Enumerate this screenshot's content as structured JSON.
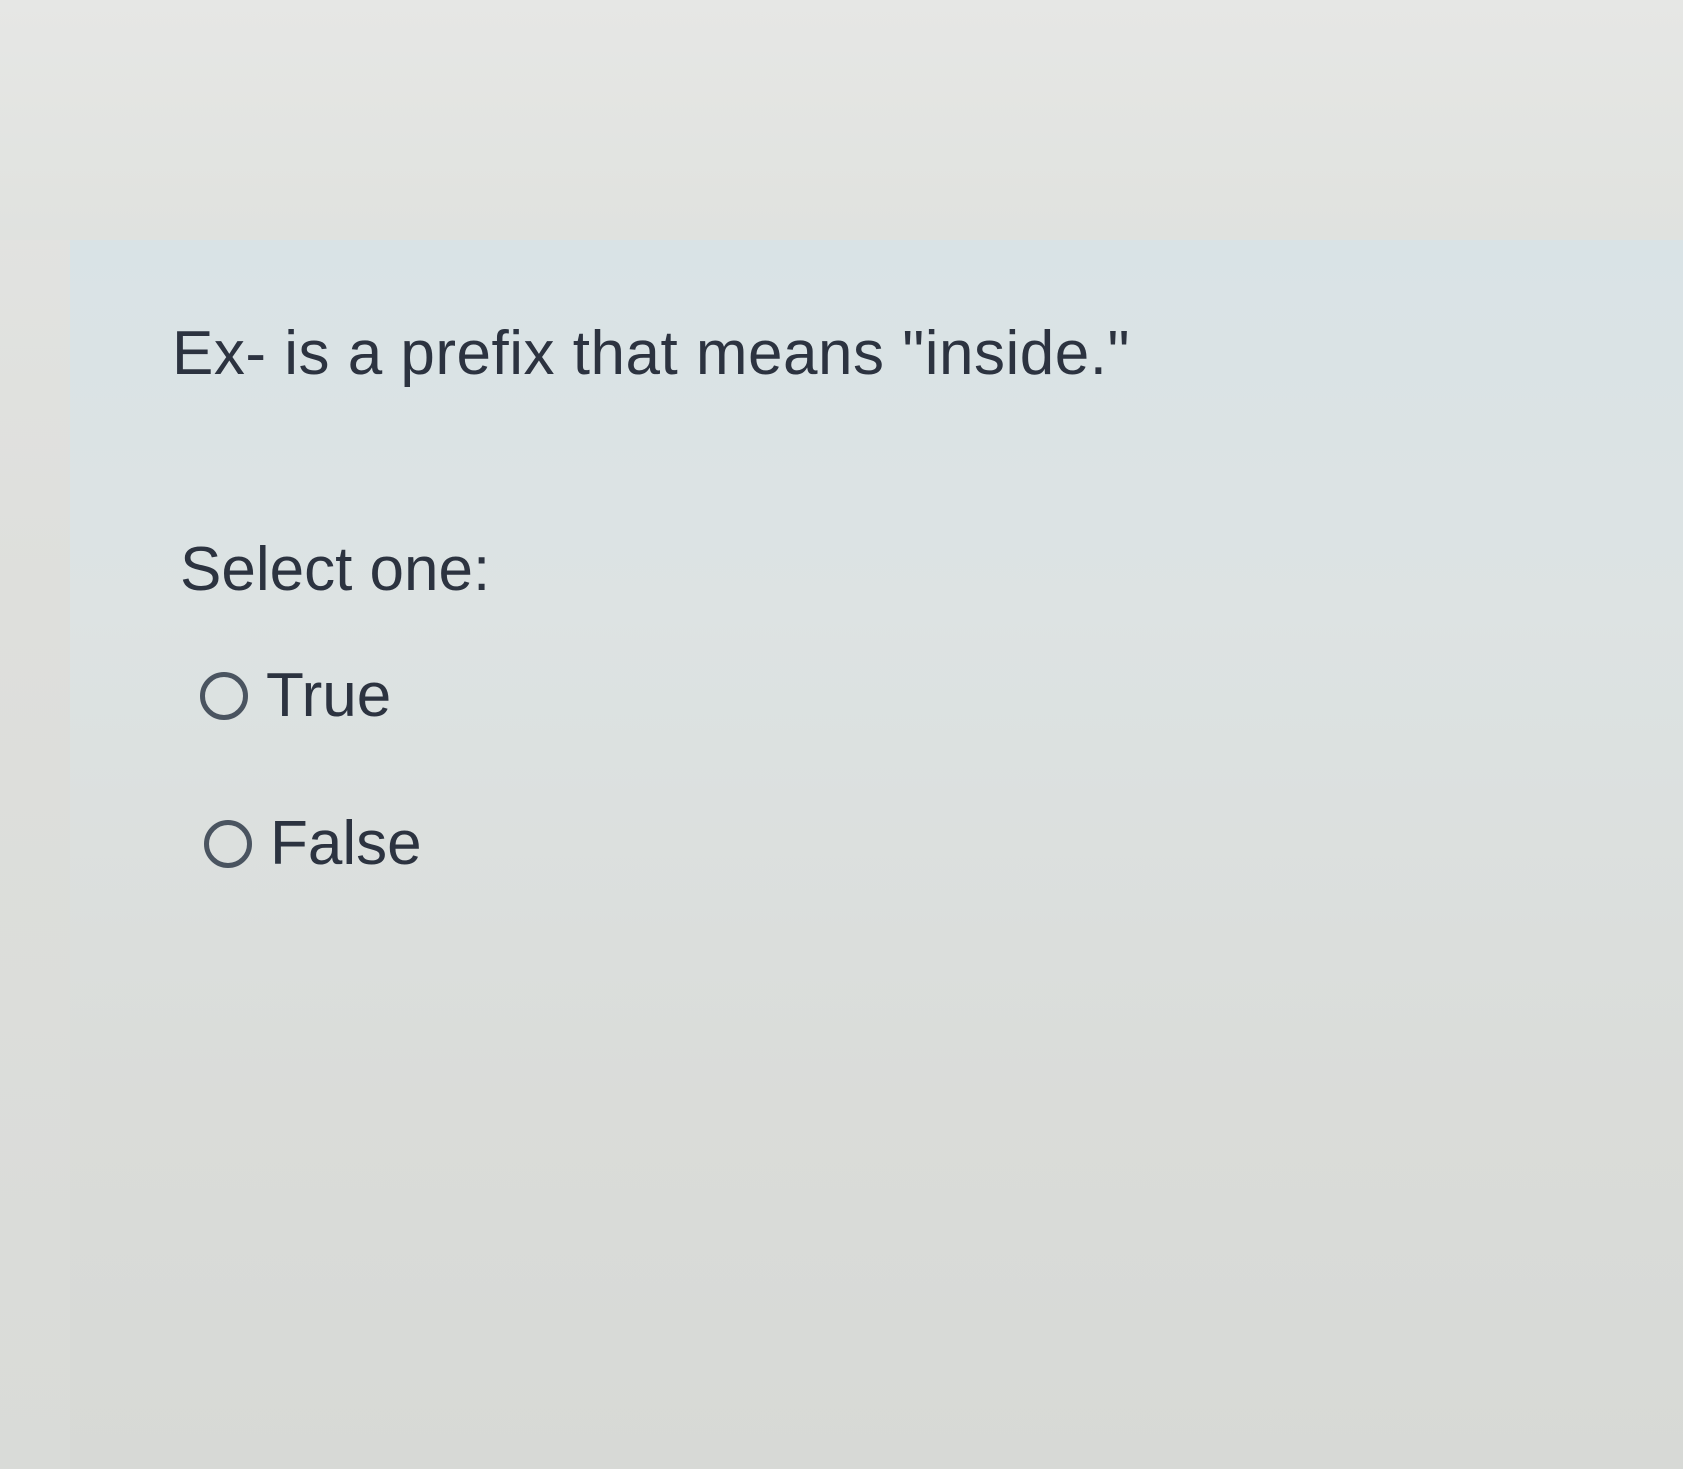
{
  "question": {
    "text": "Ex- is a prefix that means \"inside.\""
  },
  "answer": {
    "prompt": "Select one:",
    "options": [
      {
        "label": "True",
        "selected": false
      },
      {
        "label": "False",
        "selected": false
      }
    ]
  },
  "colors": {
    "text": "#2c3340",
    "radio_border": "#4a5460",
    "panel_background": "#dde3e3",
    "page_background": "#e4e5e3"
  }
}
